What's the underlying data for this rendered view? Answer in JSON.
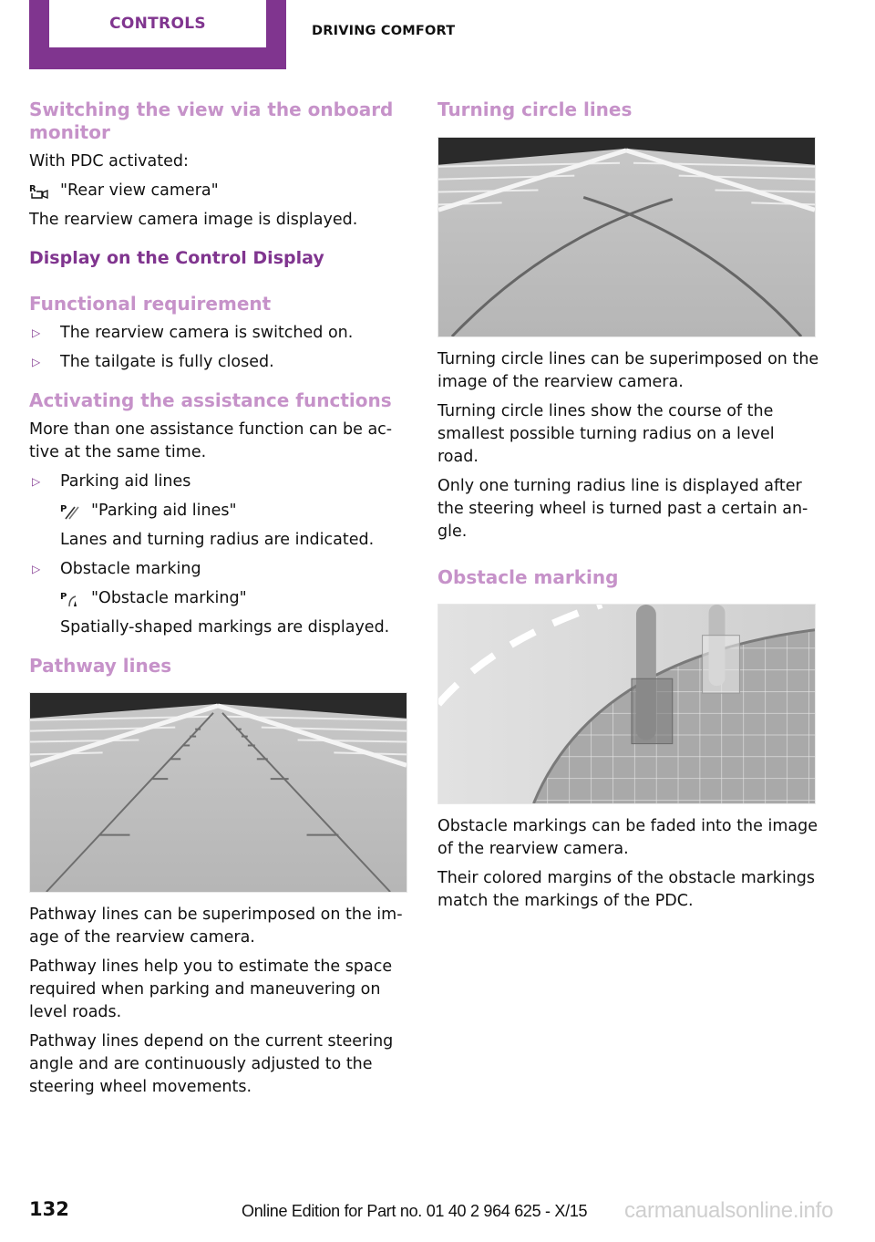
{
  "header": {
    "tab_label": "CONTROLS",
    "section_label": "DRIVING COMFORT",
    "accent_color": "#80358f"
  },
  "left": {
    "switching": {
      "heading": "Switching the view via the onboard monitor",
      "intro": "With PDC activated:",
      "menu_icon": "rear-view-camera-icon",
      "menu_item": "\"Rear view camera\"",
      "result": "The rearview camera image is displayed."
    },
    "display_heading": "Display on the Control Display",
    "functional": {
      "heading": "Functional requirement",
      "items": [
        "The rearview camera is switched on.",
        "The tailgate is fully closed."
      ]
    },
    "activating": {
      "heading": "Activating the assistance functions",
      "intro": "More than one assistance function can be ac-tive at the same time.",
      "intro_line1": "More than one assistance function can be ac-",
      "intro_line2": "tive at the same time.",
      "items": [
        {
          "title": "Parking aid lines",
          "icon": "parking-aid-lines-icon",
          "menu_item": "\"Parking aid lines\"",
          "description": "Lanes and turning radius are indicated."
        },
        {
          "title": "Obstacle marking",
          "icon": "obstacle-marking-icon",
          "menu_item": "\"Obstacle marking\"",
          "description": "Spatially-shaped markings are displayed."
        }
      ]
    },
    "pathway": {
      "heading": "Pathway lines",
      "figure_alt": "Rearview camera image with pathway lines",
      "paragraphs": [
        "Pathway lines can be superimposed on the im-age of the rearview camera.",
        "Pathway lines help you to estimate the space required when parking and maneuvering on level roads.",
        "Pathway lines depend on the current steering angle and are continuously adjusted to the steering wheel movements."
      ]
    }
  },
  "right": {
    "turning": {
      "heading": "Turning circle lines",
      "figure_alt": "Rearview camera image with turning circle lines",
      "paragraphs": [
        "Turning circle lines can be superimposed on the image of the rearview camera.",
        "Turning circle lines show the course of the smallest possible turning radius on a level road.",
        "Only one turning radius line is displayed after the steering wheel is turned past a certain an-gle."
      ]
    },
    "obstacle": {
      "heading": "Obstacle marking",
      "figure_alt": "Rearview camera image with obstacle markings",
      "paragraphs": [
        "Obstacle markings can be faded into the image of the rearview camera.",
        "Their colored margins of the obstacle markings match the markings of the PDC."
      ]
    }
  },
  "footer": {
    "page_number": "132",
    "edition": "Online Edition for Part no. 01 40 2 964 625 - X/15",
    "watermark": "carmanualsonline.info"
  }
}
